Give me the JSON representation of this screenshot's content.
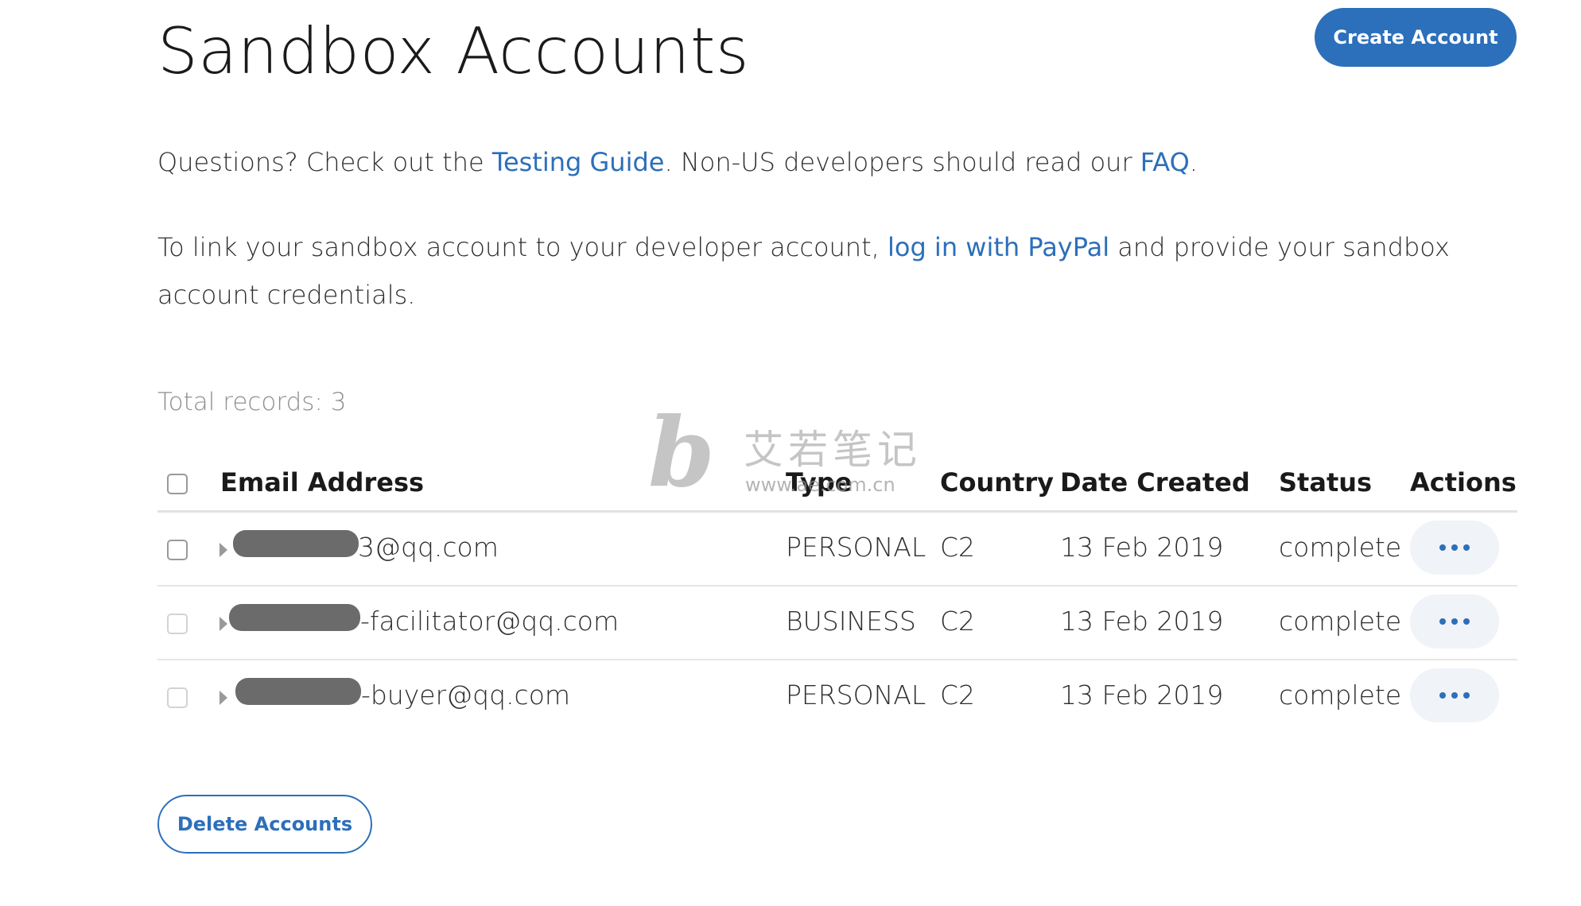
{
  "header": {
    "title": "Sandbox Accounts",
    "create_button": "Create Account"
  },
  "intro": {
    "line1_prefix": "Questions? Check out the ",
    "testing_guide_link": "Testing Guide",
    "line1_middle": ". Non-US developers should read our ",
    "faq_link": "FAQ",
    "line1_suffix": ".",
    "line2_prefix": "To link your sandbox account to your developer account, ",
    "login_link": "log in with PayPal",
    "line2_suffix": " and provide your sandbox account credentials."
  },
  "total_records": "Total records: 3",
  "table": {
    "columns": {
      "email": "Email Address",
      "type": "Type",
      "country": "Country",
      "date": "Date Created",
      "status": "Status",
      "actions": "Actions"
    },
    "rows": [
      {
        "email": "3@qq.com",
        "type": "PERSONAL",
        "country": "C2",
        "date": "13 Feb 2019",
        "status": "complete"
      },
      {
        "email": "-facilitator@qq.com",
        "type": "BUSINESS",
        "country": "C2",
        "date": "13 Feb 2019",
        "status": "complete"
      },
      {
        "email": "-buyer@qq.com",
        "type": "PERSONAL",
        "country": "C2",
        "date": "13 Feb 2019",
        "status": "complete"
      }
    ]
  },
  "delete_button": "Delete Accounts",
  "watermark": {
    "logo": "b",
    "chinese": "艾若笔记",
    "url": "www.ae.com.cn"
  },
  "colors": {
    "accent": "#2c6fbb",
    "text": "#2c2e2f",
    "muted": "#8f8f8f",
    "action_bg": "#f0f3f7",
    "redaction": "#6b6b6b"
  },
  "icons": {
    "actions": "more-horizontal-icon",
    "expand": "caret-right-icon",
    "select": "checkbox-icon"
  }
}
